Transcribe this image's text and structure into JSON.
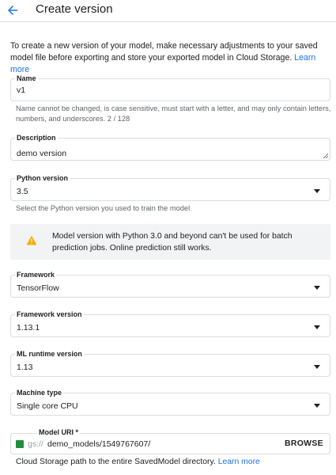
{
  "header": {
    "title": "Create version"
  },
  "intro": {
    "text": "To create a new version of your model, make necessary adjustments to your saved model file before exporting and store your exported model in Cloud Storage.",
    "link": "Learn more"
  },
  "name": {
    "label": "Name",
    "value": "v1",
    "helper": "Name cannot be changed, is case sensitive, must start with a letter, and may only contain letters, numbers, and underscores. 2 / 128"
  },
  "description": {
    "label": "Description",
    "value": "demo version"
  },
  "python": {
    "label": "Python version",
    "value": "3.5",
    "helper": "Select the Python version you used to train the model"
  },
  "warning": {
    "text": "Model version with Python 3.0 and beyond can't be used for batch prediction jobs. Online prediction still works.",
    "icon": "warning-icon",
    "color": "#f9ab00"
  },
  "framework": {
    "label": "Framework",
    "value": "TensorFlow"
  },
  "framework_version": {
    "label": "Framework version",
    "value": "1.13.1"
  },
  "runtime": {
    "label": "ML runtime version",
    "value": "1.13"
  },
  "machine": {
    "label": "Machine type",
    "value": "Single core CPU"
  },
  "model_uri": {
    "label": "Model URI *",
    "prefix": "gs://",
    "value": "demo_models/1549767607/",
    "browse": "BROWSE",
    "helper": "Cloud Storage path to the entire SavedModel directory.",
    "link": "Learn more"
  },
  "colors": {
    "accent": "#1a73e8",
    "check": "#1e8e3e"
  }
}
